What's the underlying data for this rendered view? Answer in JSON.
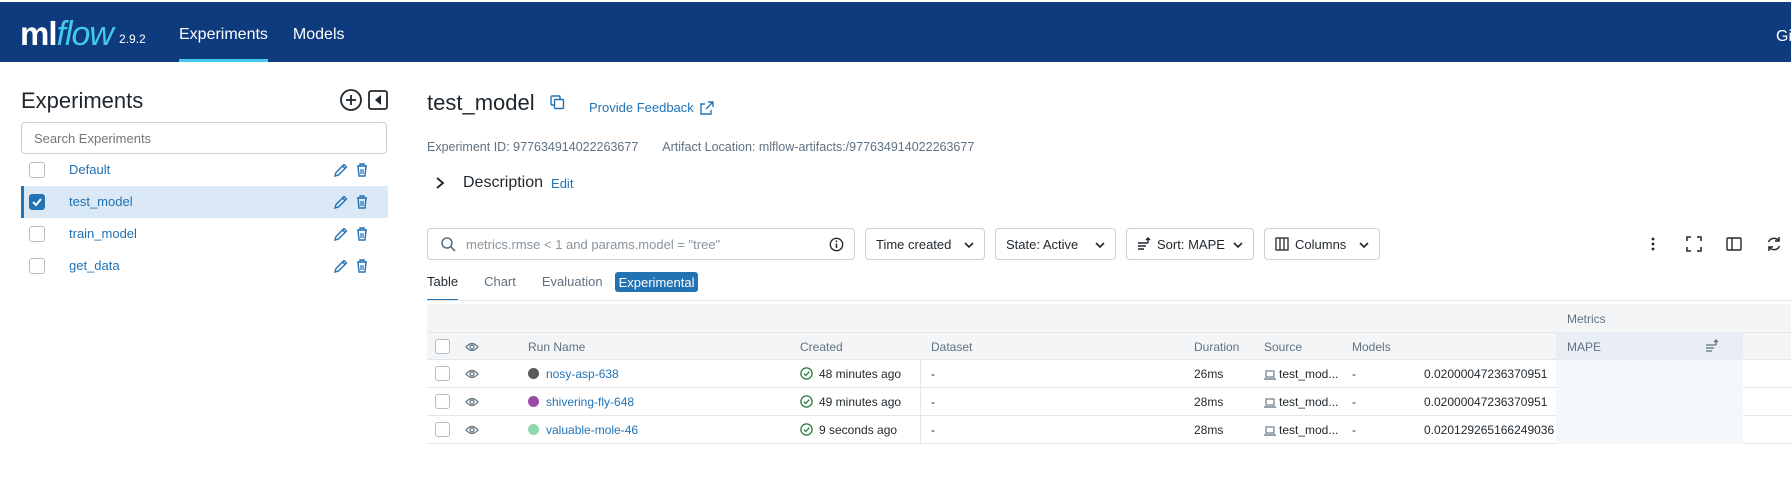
{
  "header": {
    "logo_ml": "ml",
    "logo_flow": "flow",
    "version": "2.9.2",
    "nav": [
      {
        "label": "Experiments",
        "active": true
      },
      {
        "label": "Models",
        "active": false
      }
    ],
    "right_text": "Gi"
  },
  "sidebar": {
    "title": "Experiments",
    "search_placeholder": "Search Experiments",
    "items": [
      {
        "name": "Default",
        "checked": false
      },
      {
        "name": "test_model",
        "checked": true
      },
      {
        "name": "train_model",
        "checked": false
      },
      {
        "name": "get_data",
        "checked": false
      }
    ]
  },
  "experiment": {
    "title": "test_model",
    "feedback_label": "Provide Feedback",
    "id_text": "Experiment ID: 977634914022263677",
    "artifact_text": "Artifact Location: mlflow-artifacts:/977634914022263677",
    "description_label": "Description",
    "description_edit": "Edit"
  },
  "controls": {
    "search_placeholder": "metrics.rmse < 1 and params.model = \"tree\"",
    "time_created": "Time created",
    "state": "State: Active",
    "sort": "Sort: MAPE",
    "columns": "Columns"
  },
  "tabs": {
    "table": "Table",
    "chart": "Chart",
    "evaluation": "Evaluation",
    "experimental": "Experimental"
  },
  "table": {
    "group_label": "Metrics",
    "headers": {
      "run_name": "Run Name",
      "created": "Created",
      "dataset": "Dataset",
      "duration": "Duration",
      "source": "Source",
      "models": "Models",
      "mape": "MAPE"
    },
    "rows": [
      {
        "color": "#595959",
        "run_name": "nosy-asp-638",
        "created": "48 minutes ago",
        "dataset": "-",
        "duration": "26ms",
        "source": "test_mod...",
        "models": "-",
        "mape": "0.02000047236370951"
      },
      {
        "color": "#9b4aa6",
        "run_name": "shivering-fly-648",
        "created": "49 minutes ago",
        "dataset": "-",
        "duration": "28ms",
        "source": "test_mod...",
        "models": "-",
        "mape": "0.02000047236370951"
      },
      {
        "color": "#8fd9b0",
        "run_name": "valuable-mole-46",
        "created": "9 seconds ago",
        "dataset": "-",
        "duration": "28ms",
        "source": "test_mod...",
        "models": "-",
        "mape": "0.020129265166249036"
      }
    ]
  },
  "colors": {
    "header_bg": "#0e3a7e",
    "accent": "#43c9ed",
    "link": "#2272b4",
    "success": "#277c43"
  }
}
